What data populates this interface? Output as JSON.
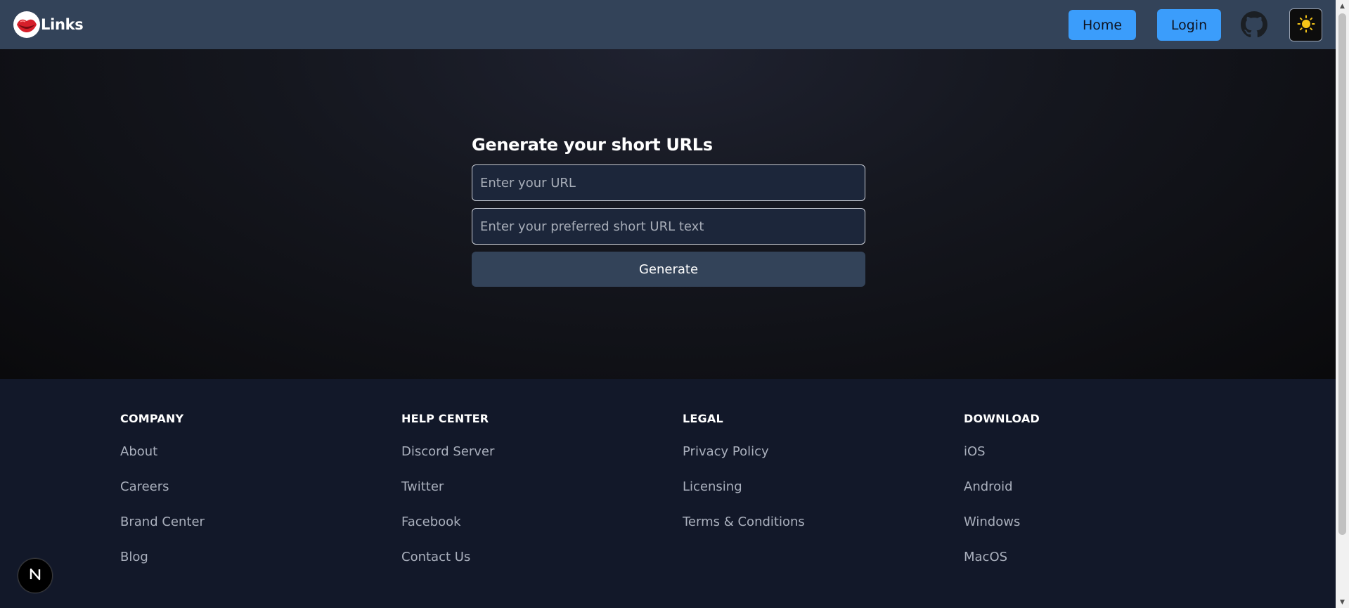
{
  "header": {
    "brand_text": "Links",
    "logo_icon": "lips-icon",
    "nav": {
      "home_label": "Home",
      "login_label": "Login"
    },
    "github_icon": "github-icon",
    "theme_icon": "sun-icon"
  },
  "main": {
    "title": "Generate your short URLs",
    "url_input": {
      "placeholder": "Enter your URL",
      "value": ""
    },
    "short_input": {
      "placeholder": "Enter your preferred short URL text",
      "value": ""
    },
    "generate_label": "Generate"
  },
  "footer": {
    "columns": [
      {
        "heading": "COMPANY",
        "links": [
          "About",
          "Careers",
          "Brand Center",
          "Blog"
        ]
      },
      {
        "heading": "HELP CENTER",
        "links": [
          "Discord Server",
          "Twitter",
          "Facebook",
          "Contact Us"
        ]
      },
      {
        "heading": "LEGAL",
        "links": [
          "Privacy Policy",
          "Licensing",
          "Terms & Conditions"
        ]
      },
      {
        "heading": "DOWNLOAD",
        "links": [
          "iOS",
          "Android",
          "Windows",
          "MacOS"
        ]
      }
    ]
  },
  "dev_badge": {
    "icon": "nextjs-icon",
    "letter": "N"
  },
  "colors": {
    "header_bg": "#334359",
    "accent_button": "#3b9dfb",
    "footer_bg": "#121829",
    "input_bg": "#1c263a",
    "generate_bg": "#334359"
  }
}
